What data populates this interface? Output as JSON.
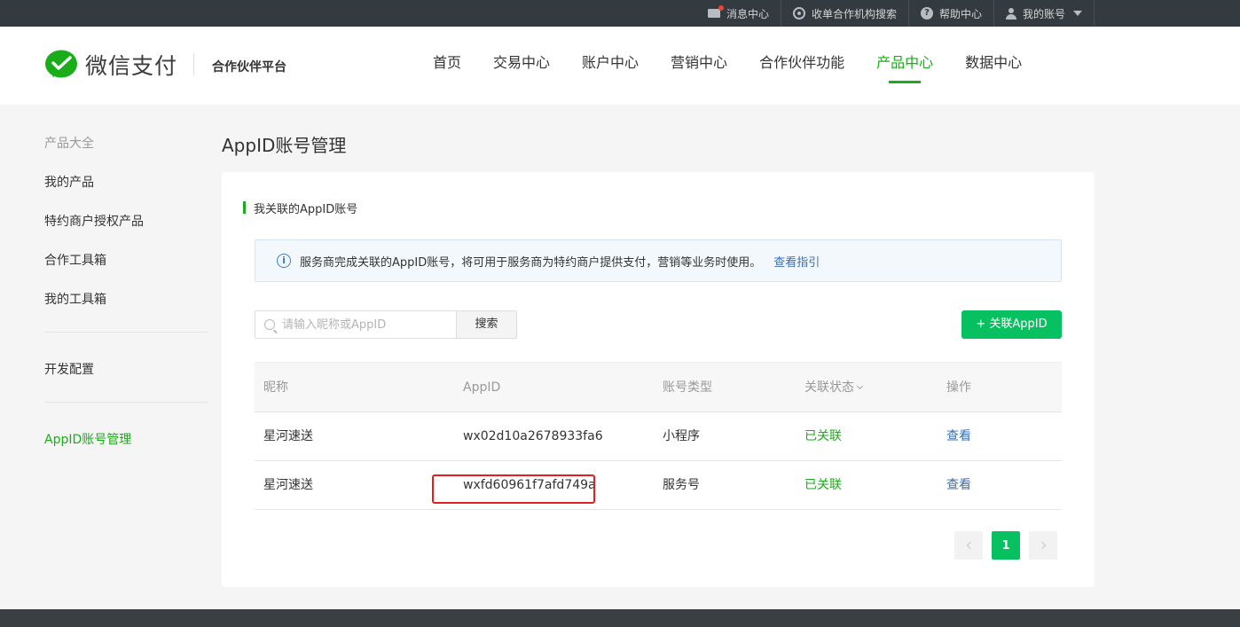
{
  "topbar": {
    "items": [
      {
        "label": "消息中心",
        "icon": "message-icon"
      },
      {
        "label": "收单合作机构搜索",
        "icon": "search-icon"
      },
      {
        "label": "帮助中心",
        "icon": "help-icon"
      },
      {
        "label": "我的账号",
        "icon": "user-icon"
      }
    ],
    "help_glyph": "?"
  },
  "header": {
    "logo_text": "微信支付",
    "platform": "合作伙伴平台",
    "nav": [
      "首页",
      "交易中心",
      "账户中心",
      "营销中心",
      "合作伙伴功能",
      "产品中心",
      "数据中心"
    ],
    "active_nav": "产品中心"
  },
  "sidebar": {
    "group_title": "产品大全",
    "items": [
      "我的产品",
      "特约商户授权产品",
      "合作工具箱",
      "我的工具箱"
    ],
    "dev_config": "开发配置",
    "active_item": "AppID账号管理"
  },
  "main": {
    "title": "AppID账号管理",
    "section_title": "我关联的AppID账号",
    "notice": {
      "icon_glyph": "i",
      "text": "服务商完成关联的AppID账号，将可用于服务商为特约商户提供支付，营销等业务时使用。",
      "link": "查看指引"
    },
    "search": {
      "placeholder": "请输入昵称或AppID",
      "value": "",
      "button": "搜索"
    },
    "add_button": "+ 关联AppID",
    "table": {
      "headers": [
        "昵称",
        "AppID",
        "账号类型",
        "关联状态",
        "操作"
      ],
      "rows": [
        {
          "nickname": "星河速送",
          "appid": "wx02d10a2678933fa6",
          "type": "小程序",
          "status": "已关联",
          "action": "查看"
        },
        {
          "nickname": "星河速送",
          "appid": "wxfd60961f7afd749a",
          "type": "服务号",
          "status": "已关联",
          "action": "查看"
        }
      ]
    },
    "pagination": {
      "current": "1"
    }
  },
  "colors": {
    "brand_green": "#1aad19",
    "button_green": "#07c160",
    "link_blue": "#3a6eb4",
    "highlight_red": "#e02020"
  }
}
